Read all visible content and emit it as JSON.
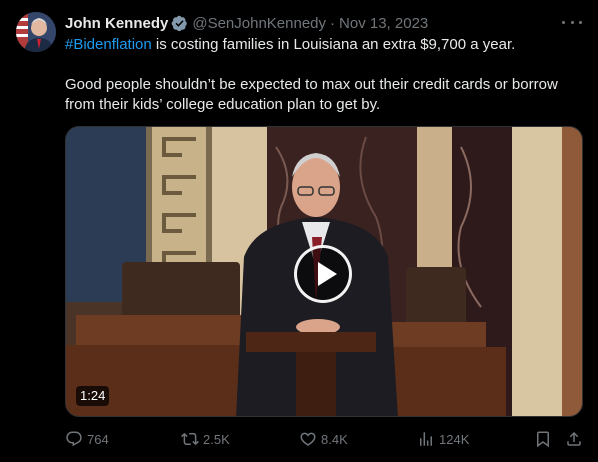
{
  "author": {
    "name": "John Kennedy",
    "handle": "@SenJohnKennedy",
    "separator": "·",
    "date": "Nov 13, 2023"
  },
  "tweet": {
    "hashtag": "#Bidenflation",
    "line1_rest": " is costing families in Louisiana an extra $9,700 a year.",
    "paragraph2": "Good people shouldn’t be expected to max out their credit cards or borrow from their kids’ college education plan to get by."
  },
  "video": {
    "duration": "1:24"
  },
  "actions": {
    "replies": "764",
    "reposts": "2.5K",
    "likes": "8.4K",
    "views": "124K"
  },
  "icons": {
    "more": "more-icon",
    "verified": "verified-badge-icon",
    "reply": "reply-icon",
    "repost": "repost-icon",
    "like": "like-icon",
    "views": "views-icon",
    "bookmark": "bookmark-icon",
    "share": "share-icon",
    "play": "play-icon"
  },
  "colors": {
    "background": "#000000",
    "text": "#e7e9ea",
    "muted": "#71767b",
    "link": "#1d9bf0",
    "verified": "#829aab"
  }
}
